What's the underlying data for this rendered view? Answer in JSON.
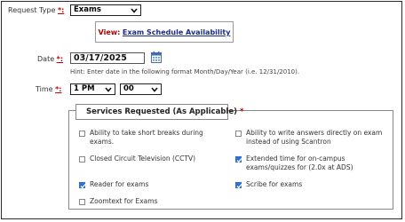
{
  "request_type": {
    "label": "Request Type",
    "required_mark": "*:",
    "value": "Exams"
  },
  "view_link": {
    "prefix": "View:",
    "link_text": "Exam Schedule Availability"
  },
  "date": {
    "label": "Date",
    "required_mark": "*:",
    "value": "03/17/2025",
    "hint": "Hint: Enter date in the following format Month/Day/Year (i.e. 12/31/2010)."
  },
  "time": {
    "label": "Time",
    "required_mark": "*:",
    "hour": "1 PM",
    "minute": "00"
  },
  "services": {
    "legend": "Services Requested (As Applicable)",
    "required_mark": "*",
    "options": [
      {
        "label": "Ability to take short breaks during exams.",
        "checked": false
      },
      {
        "label": "Ability to write answers directly on exam instead of using Scantron",
        "checked": false
      },
      {
        "label": "Closed Circuit Television (CCTV)",
        "checked": false
      },
      {
        "label": "Extended time for on-campus exams/quizzes for (2.0x at ADS)",
        "checked": true
      },
      {
        "label": "Reader for exams",
        "checked": true
      },
      {
        "label": "Scribe for exams",
        "checked": true
      },
      {
        "label": "Zoomtext for Exams",
        "checked": false
      }
    ]
  },
  "colors": {
    "required": "#cc0000",
    "link": "#1a2a8a",
    "checkbox_checked": "#2f6fd6"
  },
  "icons": {
    "dropdown": "chevron-down-icon",
    "calendar": "calendar-icon",
    "checked": "checkmark-icon"
  }
}
